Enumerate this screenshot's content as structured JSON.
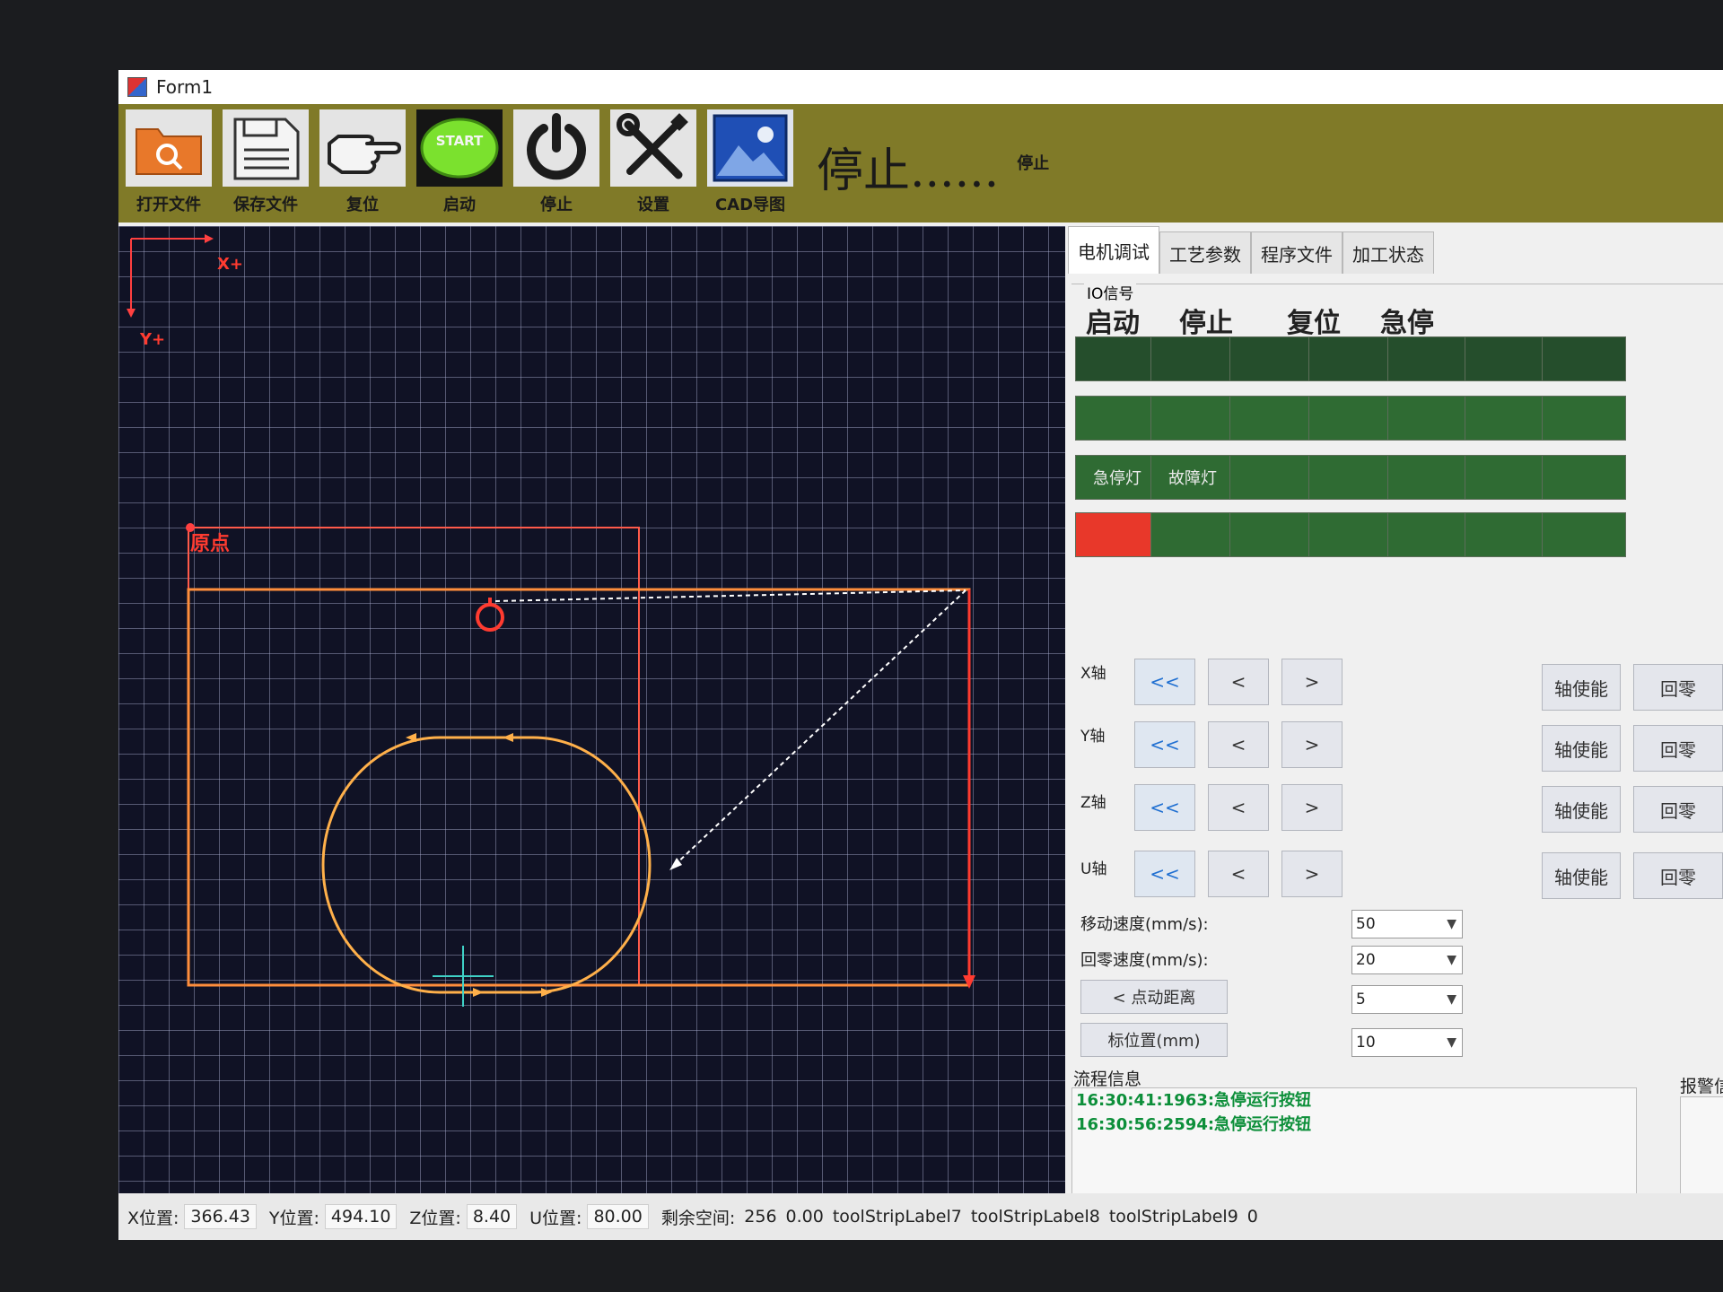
{
  "window": {
    "title": "Form1"
  },
  "toolbar": {
    "buttons": [
      {
        "label": "打开文件",
        "icon": "open-folder-icon"
      },
      {
        "label": "保存文件",
        "icon": "save-file-icon"
      },
      {
        "label": "复位",
        "icon": "pointing-hand-icon"
      },
      {
        "label": "启动",
        "icon": "start-button-icon",
        "icon_text": "START"
      },
      {
        "label": "停止",
        "icon": "power-icon"
      },
      {
        "label": "设置",
        "icon": "tools-icon"
      },
      {
        "label": "CAD导图",
        "icon": "image-icon"
      }
    ],
    "status_large": "停止......",
    "status_small": "停止"
  },
  "canvas": {
    "axis_x_label": "X+",
    "axis_y_label": "Y+",
    "origin_label": "原点"
  },
  "tabs": [
    "电机调试",
    "工艺参数",
    "程序文件",
    "加工状态"
  ],
  "active_tab": "电机调试",
  "io": {
    "group_label": "IO信号",
    "headers": [
      "启动",
      "停止",
      "复位",
      "急停"
    ],
    "row3_labels": [
      "急停灯",
      "故障灯"
    ],
    "colors": {
      "on": "#2f6b33",
      "off": "#254e2c",
      "alarm": "#e8382a"
    }
  },
  "axes": [
    {
      "label": "X轴",
      "back": "<<",
      "left": "<",
      "right": ">",
      "enable": "轴使能",
      "home": "回零"
    },
    {
      "label": "Y轴",
      "back": "<<",
      "left": "<",
      "right": ">",
      "enable": "轴使能",
      "home": "回零"
    },
    {
      "label": "Z轴",
      "back": "<<",
      "left": "<",
      "right": ">",
      "enable": "轴使能",
      "home": "回零"
    },
    {
      "label": "U轴",
      "back": "<<",
      "left": "<",
      "right": ">",
      "enable": "轴使能",
      "home": "回零"
    }
  ],
  "params": {
    "move_speed_label": "移动速度(mm/s):",
    "move_speed_value": "50",
    "home_speed_label": "回零速度(mm/s):",
    "home_speed_value": "20",
    "jog_button": "< 点动距离",
    "jog_value": "5",
    "pos_button": "标位置(mm)",
    "pos_value": "10"
  },
  "flow": {
    "label": "流程信息",
    "lines": [
      "16:30:41:1963:急停运行按钮",
      "16:30:56:2594:急停运行按钮"
    ]
  },
  "alarm": {
    "label": "报警信息"
  },
  "statusbar": {
    "x_label": "X位置:",
    "x_value": "366.43",
    "y_label": "Y位置:",
    "y_value": "494.10",
    "z_label": "Z位置:",
    "z_value": "8.40",
    "u_label": "U位置:",
    "u_value": "80.00",
    "space_label": "剩余空间:",
    "space_value": "256",
    "extra_value": "0.00",
    "label7": "toolStripLabel7",
    "label8": "toolStripLabel8",
    "label9": "toolStripLabel9",
    "last_value": "0"
  }
}
